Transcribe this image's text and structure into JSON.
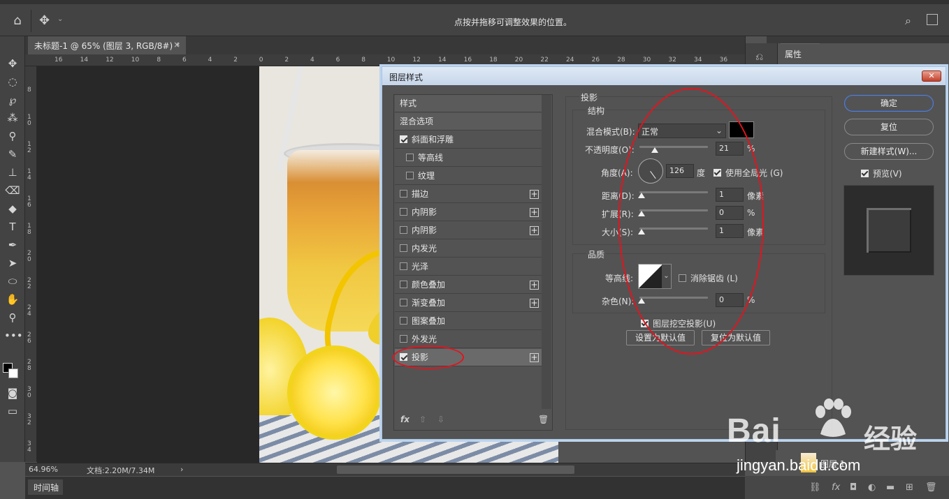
{
  "options_bar": {
    "hint": "点按并拖移可调整效果的位置。"
  },
  "document": {
    "tab_title": "未标题-1 @ 65% (图层 3, RGB/8#) *",
    "close": "×"
  },
  "ruler": {
    "h_ticks": [
      "16",
      "14",
      "12",
      "10",
      "8",
      "6",
      "4",
      "2",
      "0",
      "2",
      "4",
      "6",
      "8",
      "10",
      "12",
      "14",
      "16",
      "18",
      "20",
      "22",
      "24",
      "26",
      "28",
      "30",
      "32",
      "34",
      "36"
    ],
    "v_ticks": [
      "8",
      "1 0",
      "1 2",
      "1 4",
      "1 6",
      "1 8",
      "2 0",
      "2 2",
      "2 4",
      "2 6",
      "2 8",
      "3 0",
      "3 2",
      "3 4"
    ]
  },
  "status": {
    "zoom": "64.96%",
    "doc_info": "文档:2.20M/7.34M",
    "arrow": "›"
  },
  "timeline": {
    "label": "时间轴"
  },
  "right_panel": {
    "tab": "属性",
    "layer_name": "图层 1"
  },
  "dialog": {
    "title": "图层样式",
    "close": "✕",
    "styles": [
      {
        "label": "样式",
        "kind": "header"
      },
      {
        "label": "混合选项",
        "kind": "header"
      },
      {
        "label": "斜面和浮雕",
        "checked": true
      },
      {
        "label": "等高线",
        "checked": false,
        "indent": true
      },
      {
        "label": "纹理",
        "checked": false,
        "indent": true
      },
      {
        "label": "描边",
        "checked": false,
        "plus": true
      },
      {
        "label": "内阴影",
        "checked": false,
        "plus": true
      },
      {
        "label": "内阴影",
        "checked": false,
        "plus": true
      },
      {
        "label": "内发光",
        "checked": false
      },
      {
        "label": "光泽",
        "checked": false
      },
      {
        "label": "颜色叠加",
        "checked": false,
        "plus": true
      },
      {
        "label": "渐变叠加",
        "checked": false,
        "plus": true
      },
      {
        "label": "图案叠加",
        "checked": false
      },
      {
        "label": "外发光",
        "checked": false
      },
      {
        "label": "投影",
        "checked": true,
        "plus": true,
        "selected": true
      }
    ],
    "list_footer": {
      "fx": "fx",
      "up": "⇧",
      "down": "⇩",
      "trash": "🗑"
    },
    "section_title": "投影",
    "structure": {
      "title": "结构",
      "blend_mode_label": "混合模式(B):",
      "blend_mode_value": "正常",
      "shadow_color": "#000000",
      "opacity_label": "不透明度(O):",
      "opacity_value": "21",
      "opacity_unit": "%",
      "angle_label": "角度(A):",
      "angle_value": "126",
      "angle_unit": "度",
      "global_light_label": "使用全局光 (G)",
      "global_light_checked": true,
      "distance_label": "距离(D):",
      "distance_value": "1",
      "distance_unit": "像素",
      "spread_label": "扩展(R):",
      "spread_value": "0",
      "spread_unit": "%",
      "size_label": "大小(S):",
      "size_value": "1",
      "size_unit": "像素"
    },
    "quality": {
      "title": "品质",
      "contour_label": "等高线:",
      "anti_alias_label": "消除锯齿 (L)",
      "anti_alias_checked": false,
      "noise_label": "杂色(N):",
      "noise_value": "0",
      "noise_unit": "%"
    },
    "knockout_label": "图层挖空投影(U)",
    "knockout_checked": true,
    "set_default": "设置为默认值",
    "reset_default": "复位为默认值",
    "buttons": {
      "ok": "确定",
      "reset": "复位",
      "new_style": "新建样式(W)...",
      "preview": "预览(V)"
    },
    "preview_checked": true
  },
  "watermark": {
    "brand": "Bai",
    "brand_tail": "经验",
    "url": "jingyan.baidu.com"
  },
  "colors": {
    "accent_red": "#e3141e",
    "dialog_border": "#a8c4e0"
  }
}
